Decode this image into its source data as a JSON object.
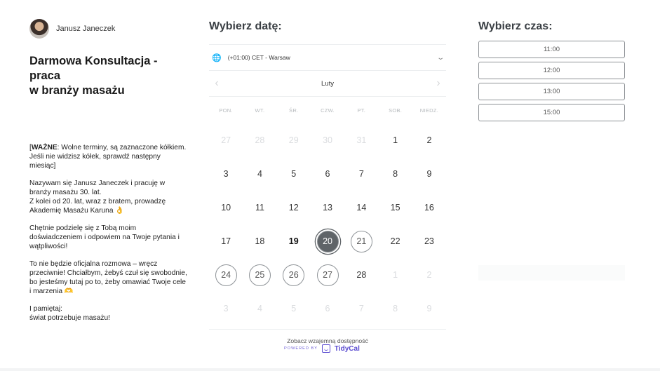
{
  "host": {
    "name": "Janusz Janeczek"
  },
  "event": {
    "title_line1": "Darmowa Konsultacja - praca",
    "title_line2": "w branży masażu"
  },
  "description": {
    "p1_bold": "WAŻNE",
    "p1_open": "[",
    "p1_rest": ": Wolne terminy, są zaznaczone kółkiem.",
    "p1_line2": "Jeśli nie widzisz kółek, sprawdź następny miesiąc]",
    "p2_line1": "Nazywam się Janusz Janeczek i pracuję w branży masażu 30. lat.",
    "p2_line2": "Z kolei od 20. lat, wraz z bratem, prowadzę Akademię Masażu Karuna 👌",
    "p3": "Chętnie podzielę się z Tobą moim doświadczeniem i odpowiem na Twoje pytania i wątpliwości!",
    "p4": "To nie będzie oficjalna rozmowa – wręcz przeciwnie! Chciałbym, żebyś czuł się swobodnie, bo jesteśmy tutaj po to, żeby omawiać Twoje cele i marzenia 🫶",
    "p5_line1": "I pamiętaj:",
    "p5_line2": "świat potrzebuje masażu!"
  },
  "date_picker": {
    "heading": "Wybierz datę:",
    "timezone": "(+01:00) CET - Warsaw",
    "month": "Luty",
    "weekdays": [
      "PON.",
      "WT.",
      "ŚR.",
      "CZW.",
      "PT.",
      "SOB.",
      "NIEDZ."
    ],
    "weeks": [
      [
        "27",
        "28",
        "29",
        "30",
        "31",
        "1",
        "2"
      ],
      [
        "3",
        "4",
        "5",
        "6",
        "7",
        "8",
        "9"
      ],
      [
        "10",
        "11",
        "12",
        "13",
        "14",
        "15",
        "16"
      ],
      [
        "17",
        "18",
        "19",
        "20",
        "21",
        "22",
        "23"
      ],
      [
        "24",
        "25",
        "26",
        "27",
        "28",
        "1",
        "2"
      ],
      [
        "3",
        "4",
        "5",
        "6",
        "7",
        "8",
        "9"
      ]
    ],
    "mutual_link": "Zobacz wzajemną dostępność"
  },
  "time_picker": {
    "heading": "Wybierz czas:",
    "slots": [
      "11:00",
      "12:00",
      "13:00",
      "15:00"
    ]
  },
  "footer": {
    "powered_by": "POWERED BY",
    "brand": "TidyCal"
  },
  "colors": {
    "brand": "#5a4bd0",
    "selected_day": "#5f6468"
  }
}
